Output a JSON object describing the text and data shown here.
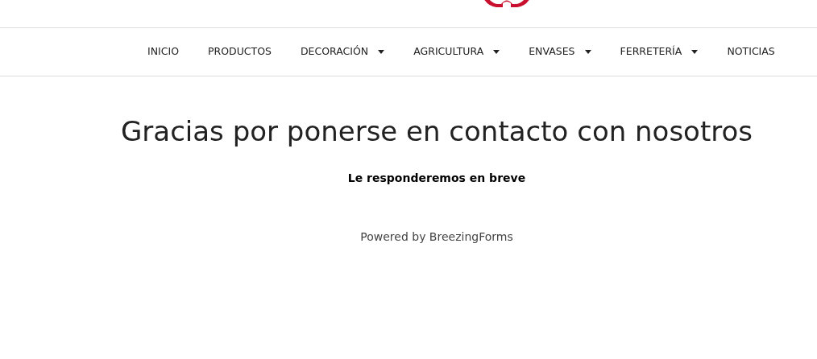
{
  "nav": {
    "items": [
      {
        "label": "INICIO",
        "dropdown": false
      },
      {
        "label": "PRODUCTOS",
        "dropdown": false
      },
      {
        "label": "DECORACIÓN",
        "dropdown": true
      },
      {
        "label": "AGRICULTURA",
        "dropdown": true
      },
      {
        "label": "ENVASES",
        "dropdown": true
      },
      {
        "label": "FERRETERÍA",
        "dropdown": true
      },
      {
        "label": "NOTICIAS",
        "dropdown": false
      }
    ]
  },
  "content": {
    "title": "Gracias por ponerse en contacto con nosotros",
    "subtitle": "Le responderemos en breve",
    "powered_by": "Powered by BreezingForms"
  }
}
